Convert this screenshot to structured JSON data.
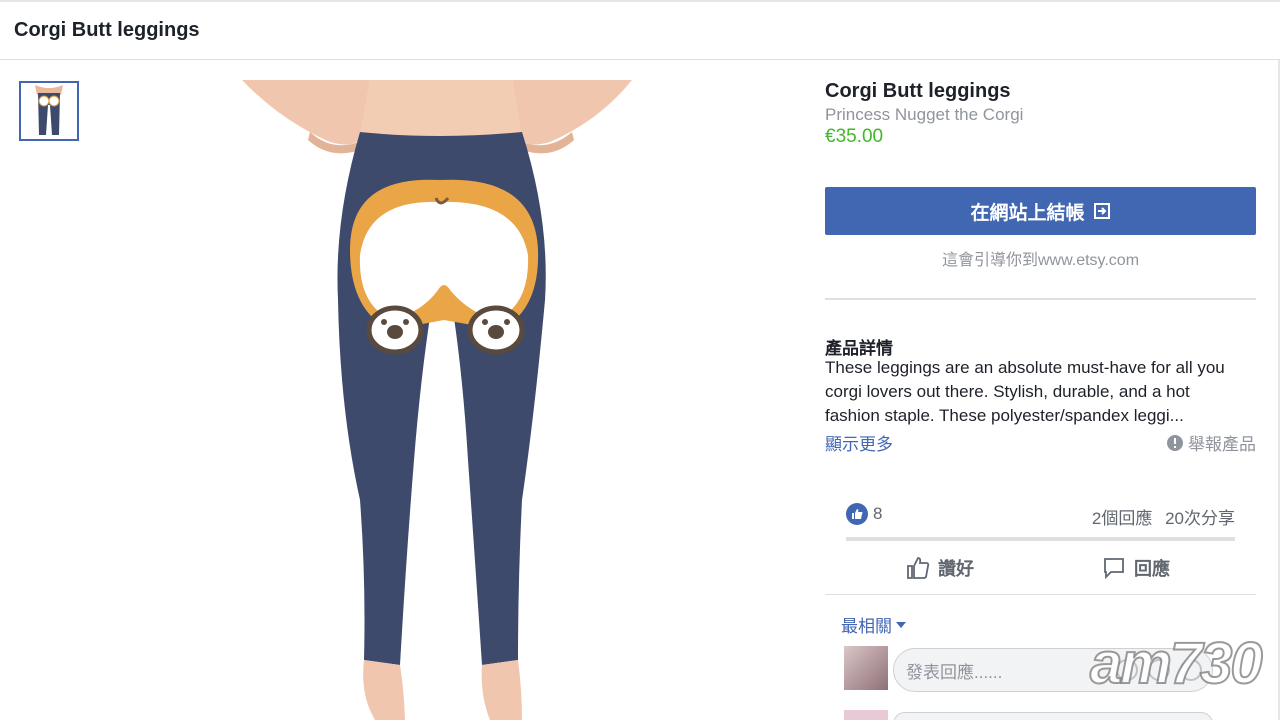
{
  "header": {
    "title": "Corgi Butt leggings"
  },
  "gallery": {
    "thumbnail_icon": "leggings-thumbnail",
    "main_image_icon": "corgi-leggings-photo"
  },
  "product": {
    "title": "Corgi Butt leggings",
    "seller": "Princess Nugget the Corgi",
    "price": "€35.00",
    "checkout_label": "在網站上結帳",
    "checkout_icon": "external-link-icon",
    "redirect_note": "這會引導你到www.etsy.com",
    "details_heading": "產品詳情",
    "details_text": "These leggings are an absolute must-have for all you corgi lovers out there. Stylish, durable, and a hot fashion staple. These polyester/spandex leggi...",
    "show_more": "顯示更多",
    "report": "舉報產品"
  },
  "social": {
    "like_count": "8",
    "comments": "2個回應",
    "shares": "20次分享",
    "like_label": "讚好",
    "comment_label": "回應",
    "sort_label": "最相關",
    "comment_placeholder": "發表回應......"
  },
  "watermark": "am730",
  "colors": {
    "accent": "#4267b2",
    "price": "#42b72a",
    "muted": "#90949c",
    "leggings": "#3d4a6b"
  }
}
